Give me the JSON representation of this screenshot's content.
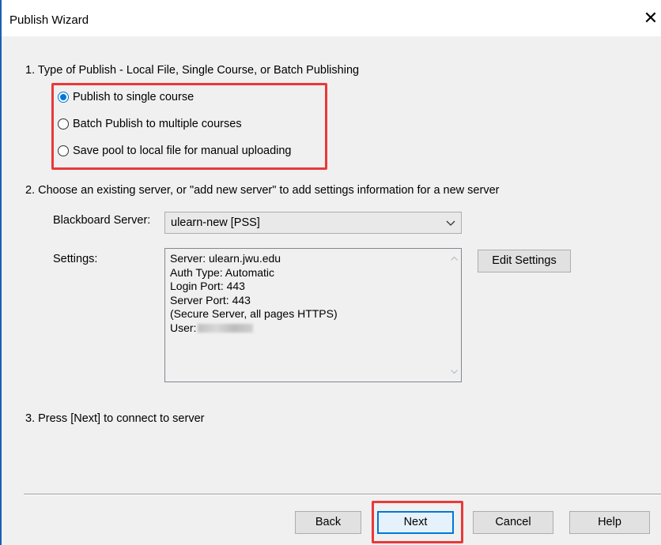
{
  "window": {
    "title": "Publish Wizard",
    "close_glyph": "✕"
  },
  "step1": {
    "label": "1.  Type of Publish - Local File, Single Course, or Batch Publishing",
    "options": [
      {
        "label": "Publish to single course",
        "selected": true
      },
      {
        "label": "Batch Publish to multiple courses",
        "selected": false
      },
      {
        "label": "Save pool to local file for manual uploading",
        "selected": false
      }
    ]
  },
  "step2": {
    "label": "2.  Choose an existing server, or \"add new server\" to add settings information for a new server",
    "server_label": "Blackboard Server:",
    "server_value": "ulearn-new [PSS]",
    "settings_label": "Settings:",
    "settings_lines": [
      "Server: ulearn.jwu.edu",
      "Auth Type: Automatic",
      "Login Port: 443",
      "Server Port: 443",
      "(Secure Server, all pages HTTPS)",
      "User:"
    ],
    "edit_settings_label": "Edit Settings"
  },
  "step3": {
    "label": "3.  Press [Next] to connect to server"
  },
  "buttons": {
    "back": "Back",
    "next": "Next",
    "cancel": "Cancel",
    "help": "Help"
  },
  "colors": {
    "highlight": "#e8393a",
    "accent": "#0078d7"
  },
  "icons": {
    "close": "close-icon",
    "dropdown": "chevron-down-icon",
    "scroll_up": "scroll-up-icon",
    "scroll_down": "scroll-down-icon"
  }
}
